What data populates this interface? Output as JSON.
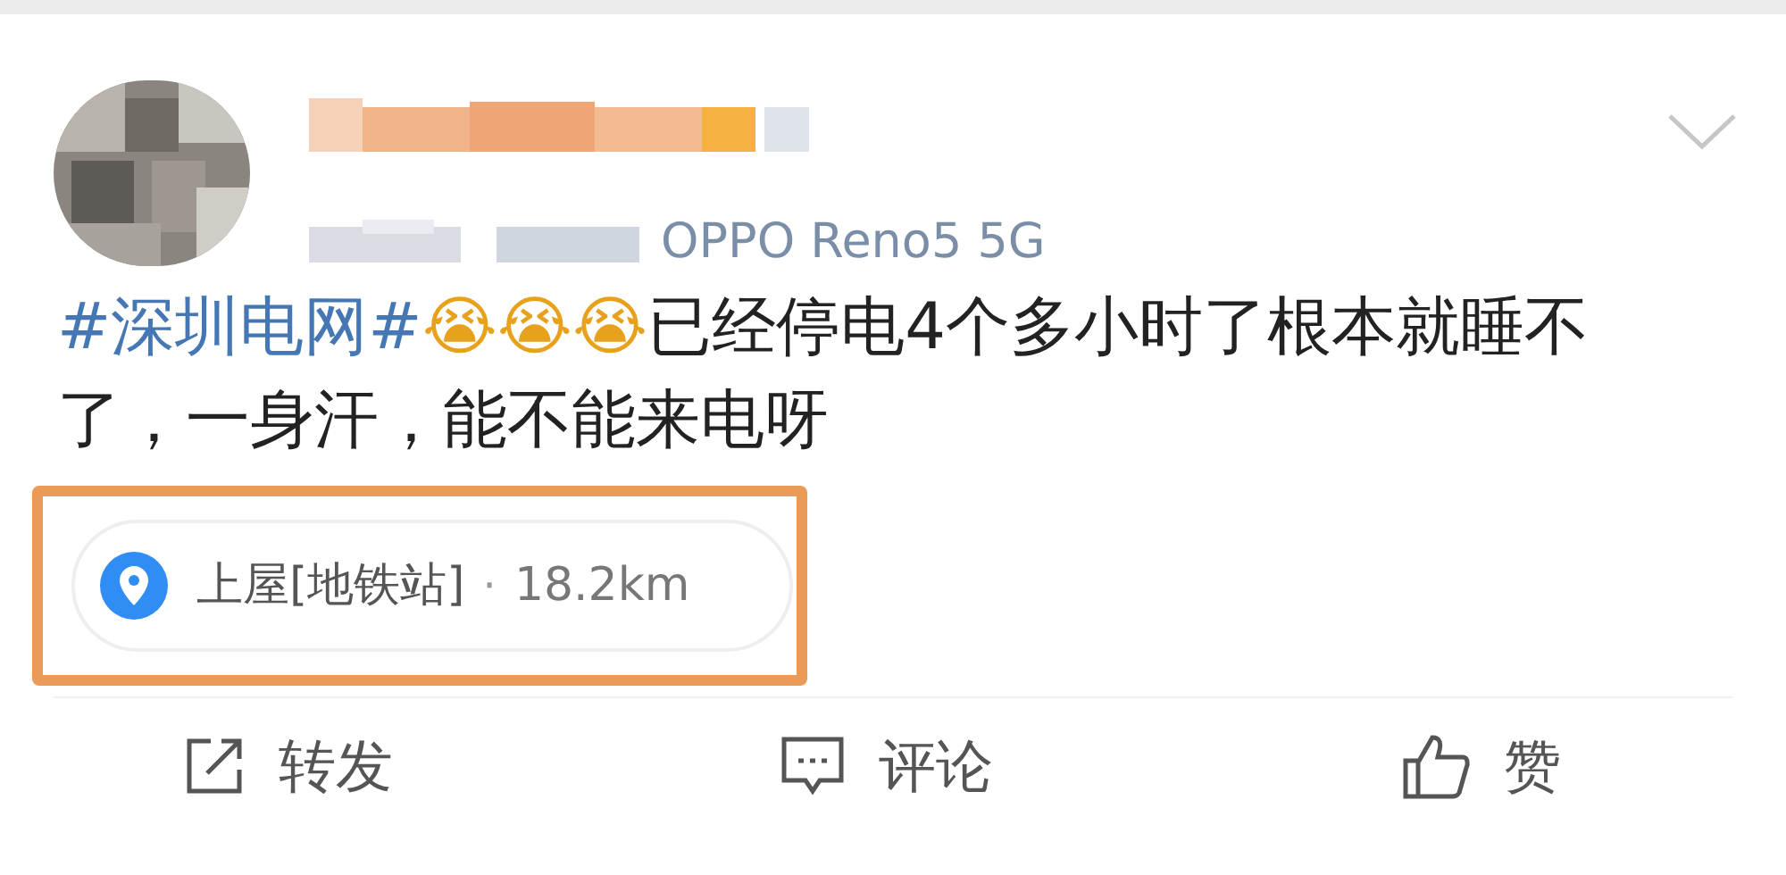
{
  "post": {
    "source": "OPPO Reno5 5G",
    "text_parts": [
      {
        "kind": "hashtag",
        "text": "#深圳电网#"
      },
      {
        "kind": "emoji",
        "text": "😭"
      },
      {
        "kind": "emoji",
        "text": "😭"
      },
      {
        "kind": "emoji",
        "text": "😭"
      },
      {
        "kind": "plain",
        "text": "已经停电4个多小时了根本就睡不了，一身汗，能不能来电呀"
      }
    ],
    "location": {
      "place": "上屋[地铁站]",
      "separator": "·",
      "distance": "18.2km",
      "highlighted": true
    }
  },
  "actions": [
    {
      "kind": "repost",
      "label": "转发"
    },
    {
      "kind": "comment",
      "label": "评论"
    },
    {
      "kind": "like",
      "label": "赞"
    }
  ]
}
